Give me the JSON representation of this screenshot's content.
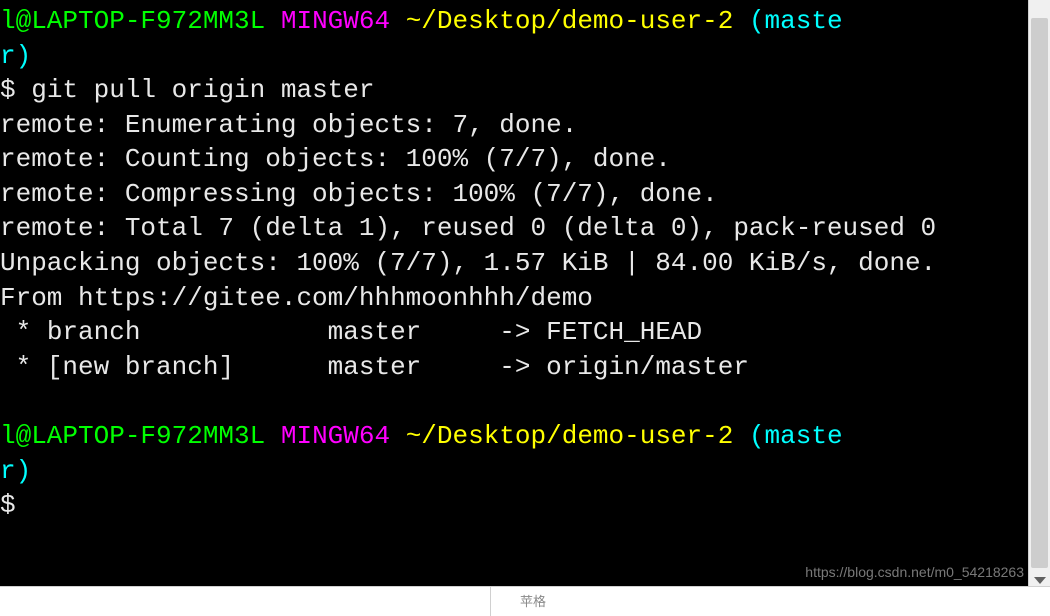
{
  "prompt1": {
    "user_host": "l@LAPTOP-F972MM3L",
    "shell": "MINGW64",
    "path": "~/Desktop/demo-user-2",
    "branch_open": "(maste",
    "branch_close": "r)",
    "symbol": "$ ",
    "command": "git pull origin master"
  },
  "output": {
    "line1": "remote: Enumerating objects: 7, done.",
    "line2": "remote: Counting objects: 100% (7/7), done.",
    "line3": "remote: Compressing objects: 100% (7/7), done.",
    "line4": "remote: Total 7 (delta 1), reused 0 (delta 0), pack-reused 0",
    "line5": "Unpacking objects: 100% (7/7), 1.57 KiB | 84.00 KiB/s, done.",
    "line6": "From https://gitee.com/hhhmoonhhh/demo",
    "line7": " * branch            master     -> FETCH_HEAD",
    "line8": " * [new branch]      master     -> origin/master"
  },
  "prompt2": {
    "user_host": "l@LAPTOP-F972MM3L",
    "shell": "MINGW64",
    "path": "~/Desktop/demo-user-2",
    "branch_open": "(maste",
    "branch_close": "r)",
    "symbol": "$"
  },
  "watermark": "https://blog.csdn.net/m0_54218263",
  "bottom_label": "苹格"
}
